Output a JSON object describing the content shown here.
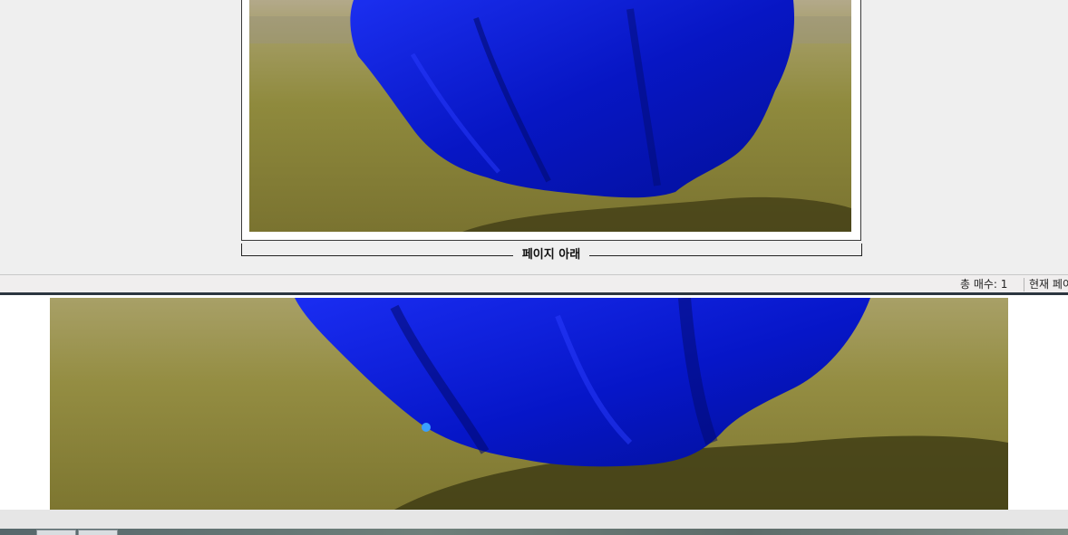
{
  "preview": {
    "footer_label": "페이지 아래"
  },
  "status_bar": {
    "total_pages": "총 매수: 1",
    "current_page": "현재 페이"
  },
  "colors": {
    "dress_blue": "#0a1fd6",
    "grass": "#8c8a3f",
    "page_background": "#efefef"
  },
  "image": {
    "subject": "blue dress on grass photo"
  }
}
